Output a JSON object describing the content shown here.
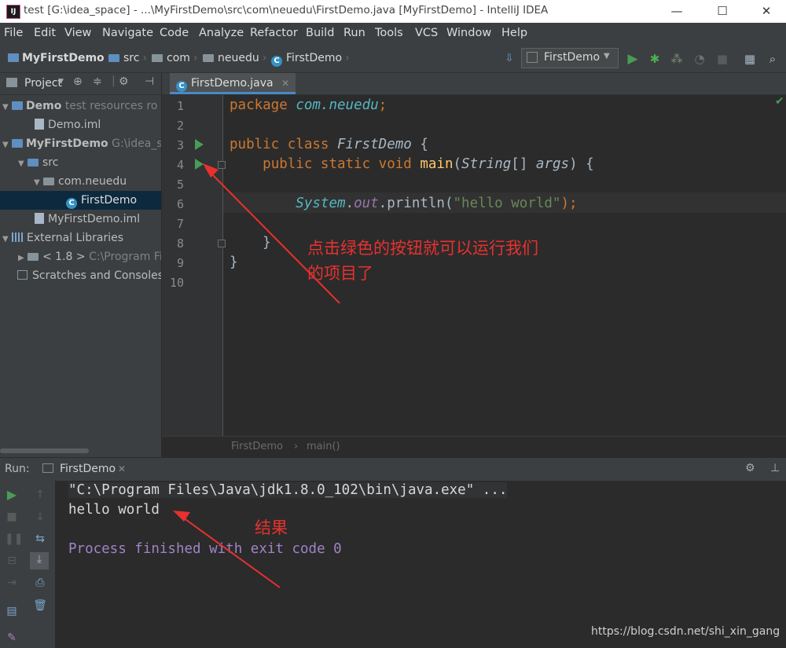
{
  "window": {
    "title": "test [G:\\idea_space] - ...\\MyFirstDemo\\src\\com\\neuedu\\FirstDemo.java [MyFirstDemo] - IntelliJ IDEA",
    "app_icon": "IJ",
    "controls": [
      "—",
      "☐",
      "✕"
    ]
  },
  "menu": [
    "File",
    "Edit",
    "View",
    "Navigate",
    "Code",
    "Analyze",
    "Refactor",
    "Build",
    "Run",
    "Tools",
    "VCS",
    "Window",
    "Help"
  ],
  "nav": {
    "crumbs": [
      "MyFirstDemo",
      "src",
      "com",
      "neuedu",
      "FirstDemo"
    ],
    "run_config": "FirstDemo"
  },
  "project": {
    "header": "Project",
    "tree": [
      {
        "name": "Demo",
        "extra": "test resources ro"
      },
      {
        "name": "Demo.iml"
      },
      {
        "name": "MyFirstDemo",
        "extra": "G:\\idea_sp"
      },
      {
        "name": "src"
      },
      {
        "name": "com.neuedu"
      },
      {
        "name": "FirstDemo"
      },
      {
        "name": "MyFirstDemo.iml"
      },
      {
        "name": "External Libraries"
      },
      {
        "name": "< 1.8 >",
        "extra": "C:\\Program Fi"
      },
      {
        "name": "Scratches and Consoles"
      }
    ]
  },
  "editor": {
    "tab": "FirstDemo.java",
    "line_numbers": [
      "1",
      "2",
      "3",
      "4",
      "5",
      "6",
      "7",
      "8",
      "9",
      "10"
    ],
    "code": {
      "l1_kw": "package",
      "l1_pkg": "com.neuedu",
      "l1_end": ";",
      "l3_kw": "public class",
      "l3_name": "FirstDemo",
      "l3_end": "{",
      "l4_kw": "public static void",
      "l4_name": "main",
      "l4_open": "(",
      "l4_type": "String",
      "l4_arr": "[]",
      "l4_arg": "args",
      "l4_end": ") {",
      "l6_sys": "System",
      "l6_dot": ".",
      "l6_out": "out",
      "l6_call": ".println(",
      "l6_str": "\"hello world\"",
      "l6_end": ");",
      "l8": "}",
      "l9": "}"
    },
    "breadcrumbs": [
      "FirstDemo",
      "main()"
    ]
  },
  "run": {
    "label": "Run:",
    "tab": "FirstDemo",
    "console": {
      "cmd": "\"C:\\Program Files\\Java\\jdk1.8.0_102\\bin\\java.exe\" ...",
      "output": "hello world",
      "exit": "Process finished with exit code 0"
    }
  },
  "annotations": {
    "note1_line1": "点击绿色的按钮就可以运行我们",
    "note1_line2": "的项目了",
    "note2": "结果",
    "color": "#e8312f"
  },
  "watermark": "https://blog.csdn.net/shi_xin_gang"
}
